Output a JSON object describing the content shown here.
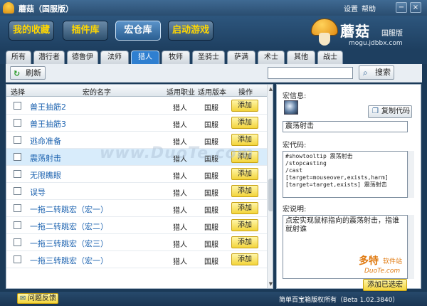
{
  "window": {
    "title": "蘑菇（国服版）",
    "links": [
      "设置",
      "帮助"
    ],
    "controls": [
      "−",
      "×"
    ]
  },
  "header": {
    "buttons": [
      {
        "label": "我的收藏",
        "color": "#ffd700"
      },
      {
        "label": "插件库",
        "color": "#ffd700"
      },
      {
        "label": "宏仓库",
        "color": "#ffffff"
      },
      {
        "label": "启动游戏",
        "color": "#ffd700"
      }
    ],
    "logo": {
      "name": "蘑菇",
      "edition": "国服版",
      "url": "mogu.jdbbx.com"
    }
  },
  "tabs": [
    "所有",
    "潜行者",
    "德鲁伊",
    "法师",
    "猎人",
    "牧师",
    "圣骑士",
    "萨满",
    "术士",
    "其他",
    "战士"
  ],
  "active_tab": "猎人",
  "toolbar": {
    "refresh_label": "刷新",
    "search_value": "",
    "search_label": "搜索"
  },
  "table": {
    "columns": [
      "选择",
      "宏的名字",
      "适用职业",
      "适用版本",
      "操作"
    ],
    "rows": [
      {
        "name": "兽王抽筋2",
        "class": "猎人",
        "version": "国服",
        "action": "添加"
      },
      {
        "name": "兽王抽筋3",
        "class": "猎人",
        "version": "国服",
        "action": "添加"
      },
      {
        "name": "逃命准备",
        "class": "猎人",
        "version": "国服",
        "action": "添加"
      },
      {
        "name": "震荡射击",
        "class": "猎人",
        "version": "国服",
        "action": "添加"
      },
      {
        "name": "无限瞧眼",
        "class": "猎人",
        "version": "国服",
        "action": "添加"
      },
      {
        "name": "误导",
        "class": "猎人",
        "version": "国服",
        "action": "添加"
      },
      {
        "name": "一拖二转跳宏（宏一）",
        "class": "猎人",
        "version": "国服",
        "action": "添加"
      },
      {
        "name": "一拖二转跳宏（宏二）",
        "class": "猎人",
        "version": "国服",
        "action": "添加"
      },
      {
        "name": "一拖三转跳宏（宏三）",
        "class": "猎人",
        "version": "国服",
        "action": "添加"
      },
      {
        "name": "一拖三转跳宏（宏一）",
        "class": "猎人",
        "version": "国服",
        "action": "添加"
      }
    ],
    "selected_index": 3
  },
  "watermark": "www.DuoTe.com",
  "detail": {
    "info_label": "宏信息:",
    "copy_label": "复制代码",
    "macro_name": "震荡射击",
    "code_label": "宏代码:",
    "code": "#showtooltip 震荡射击\n/stopcasting\n/cast\n[target=mouseover,exists,harm]\n[target=target,exists] 震荡射击",
    "desc_label": "宏说明:",
    "description": "点宏实现鼠标指向的震荡射击，指谁就射谁"
  },
  "add_to_lib_label": "添加已选宏",
  "badge": {
    "line1": "多特",
    "line2": "软件站",
    "line3": "DuoTe.com"
  },
  "footer": {
    "feedback_label": "问题反馈",
    "copyright": "简单百宝箱版权所有（Beta 1.02.3840）"
  }
}
